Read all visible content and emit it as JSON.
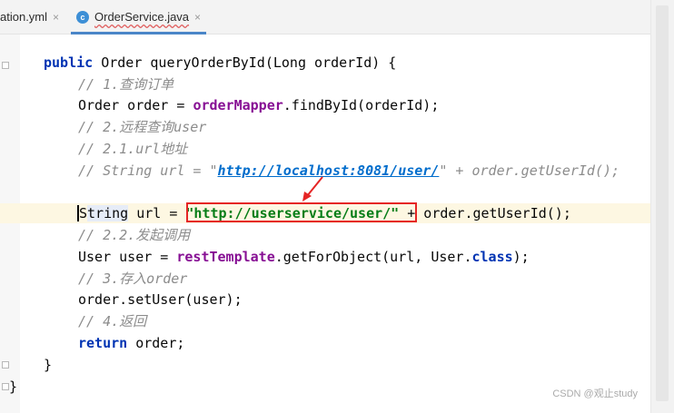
{
  "tabs": [
    {
      "label": "ation.yml",
      "close": "×"
    },
    {
      "label": "OrderService.java",
      "close": "×",
      "icon_letter": "c"
    }
  ],
  "code": {
    "l1": [
      "public",
      " Order queryOrderById(Long orderId) {"
    ],
    "l2": "// 1.查询订单",
    "l3": [
      "Order order = ",
      "orderMapper",
      ".findById(orderId);"
    ],
    "l4": "// 2.远程查询user",
    "l5": "// 2.1.url地址",
    "l6": [
      "// String url = \"",
      "http://localhost:8081/user/",
      "\" + order.getUserId();"
    ],
    "l7": [
      "S",
      "tring",
      " url = ",
      "\"http://userservice/user/\"",
      " + order.getUserId();"
    ],
    "l8": "// 2.2.发起调用",
    "l9": [
      "User user = ",
      "restTemplate",
      ".getForObject(url, User.",
      "class",
      ");"
    ],
    "l10": "// 3.存入order",
    "l11": "order.setUser(user);",
    "l12": "// 4.返回",
    "l13": [
      "return",
      " order;"
    ],
    "l14": "}",
    "l15": "}"
  },
  "watermark": "CSDN @观止study",
  "colors": {
    "keyword": "#0033b3",
    "field": "#871094",
    "comment": "#8c8c8c",
    "string": "#067d17",
    "annotation": "#e52525"
  }
}
